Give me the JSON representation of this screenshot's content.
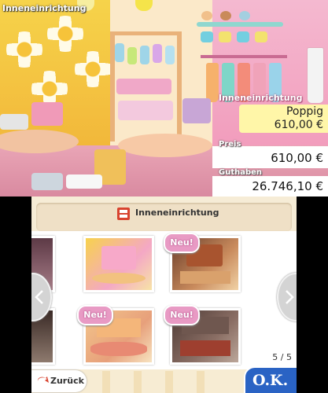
{
  "top_screen": {
    "category_label": "Inneneinrichtung",
    "info": {
      "heading": "Inneneinrichtung",
      "style": "Poppig",
      "item_price": "610,00 €",
      "price_label": "Preis",
      "price_value": "610,00 €",
      "balance_label": "Guthaben",
      "balance_value": "26.746,10 €"
    }
  },
  "bottom_screen": {
    "title": "Inneneinrichtung",
    "thumbnails": [
      {
        "badge": ""
      },
      {
        "badge": "Neu!"
      },
      {
        "badge": "Neu!"
      },
      {
        "badge": "Neu!"
      }
    ],
    "page_indicator": "5 / 5",
    "back_label": "Zurück",
    "ok_label": "O.K."
  },
  "colors": {
    "info_box": "#fff6a8",
    "badge": "#e89ac4",
    "ok_button": "#2a63c4"
  }
}
